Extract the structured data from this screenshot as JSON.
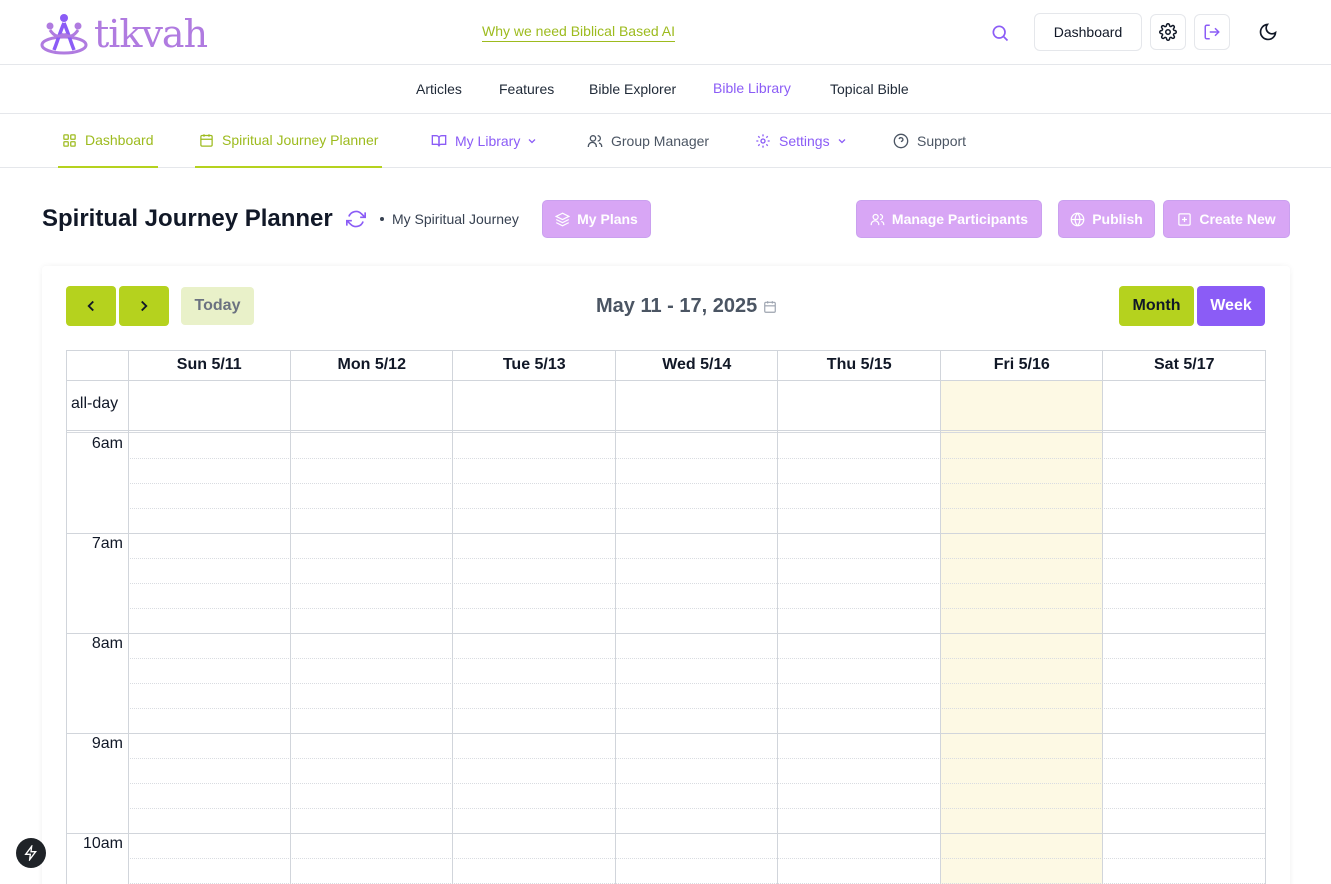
{
  "header": {
    "logo_text": "tikvah",
    "tagline": "Why we need Biblical Based AI",
    "dashboard_label": "Dashboard"
  },
  "nav": {
    "items": [
      {
        "label": "Articles"
      },
      {
        "label": "Features"
      },
      {
        "label": "Bible Explorer"
      },
      {
        "label": "Bible Library",
        "active": true
      },
      {
        "label": "Topical Bible"
      }
    ]
  },
  "tabs": {
    "items": [
      {
        "label": "Dashboard"
      },
      {
        "label": "Spiritual Journey Planner"
      },
      {
        "label": "My Library"
      },
      {
        "label": "Group Manager"
      },
      {
        "label": "Settings"
      },
      {
        "label": "Support"
      }
    ]
  },
  "page": {
    "title": "Spiritual Journey Planner",
    "journey_name": "My Spiritual Journey",
    "my_plans_label": "My Plans",
    "manage_participants_label": "Manage Participants",
    "publish_label": "Publish",
    "create_new_label": "Create New"
  },
  "calendar": {
    "today_label": "Today",
    "range_title": "May 11 - 17, 2025",
    "month_label": "Month",
    "week_label": "Week",
    "allday_label": "all-day",
    "days": [
      "Sun 5/11",
      "Mon 5/12",
      "Tue 5/13",
      "Wed 5/14",
      "Thu 5/15",
      "Fri 5/16",
      "Sat 5/17"
    ],
    "today_index": 5,
    "hours": [
      "6am",
      "7am",
      "8am",
      "9am",
      "10am"
    ]
  },
  "colors": {
    "accent_purple": "#8b5cf6",
    "accent_green": "#b5d21e",
    "today_bg": "#fdf9e4"
  }
}
